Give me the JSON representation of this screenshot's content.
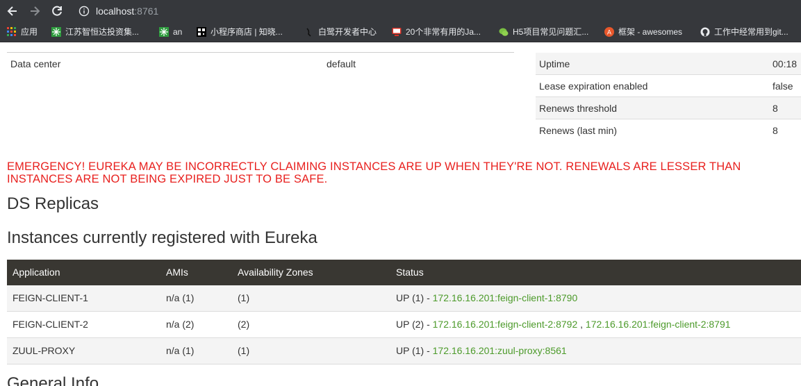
{
  "browser": {
    "url_host": "localhost",
    "url_port": ":8761",
    "bookmarks": [
      {
        "label": "应用",
        "icon": "apps-grid-icon"
      },
      {
        "label": "江苏智恒达投资集...",
        "icon": "green-pattern-icon"
      },
      {
        "label": "an",
        "icon": "green-pattern-icon"
      },
      {
        "label": "小程序商店 | 知晓...",
        "icon": "qr-square-icon"
      },
      {
        "label": "白鹭开发者中心",
        "icon": "egret-icon"
      },
      {
        "label": "20个非常有用的Ja...",
        "icon": "red-monitor-icon"
      },
      {
        "label": "H5项目常见问题汇...",
        "icon": "wechat-icon"
      },
      {
        "label": "框架 - awesomes",
        "icon": "orange-circle-icon"
      },
      {
        "label": "工作中经常用到git...",
        "icon": "github-icon"
      }
    ]
  },
  "env_info": {
    "data_center_label": "Data center",
    "data_center_value": "default"
  },
  "status_info": [
    {
      "key": "Uptime",
      "value": "00:18"
    },
    {
      "key": "Lease expiration enabled",
      "value": "false"
    },
    {
      "key": "Renews threshold",
      "value": "8"
    },
    {
      "key": "Renews (last min)",
      "value": "8"
    }
  ],
  "emergency": {
    "line1": "EMERGENCY! EUREKA MAY BE INCORRECTLY CLAIMING INSTANCES ARE UP WHEN THEY'RE NOT. RENEWALS ARE LESSER THAN",
    "line2": "INSTANCES ARE NOT BEING EXPIRED JUST TO BE SAFE."
  },
  "headings": {
    "replicas": "DS Replicas",
    "instances": "Instances currently registered with Eureka",
    "general": "General Info"
  },
  "instances": {
    "columns": [
      "Application",
      "AMIs",
      "Availability Zones",
      "Status"
    ],
    "rows": [
      {
        "app": "FEIGN-CLIENT-1",
        "amis": "n/a (1)",
        "zones": "(1)",
        "status_prefix": "UP (1) - ",
        "links": [
          "172.16.16.201:feign-client-1:8790"
        ]
      },
      {
        "app": "FEIGN-CLIENT-2",
        "amis": "n/a (2)",
        "zones": "(2)",
        "status_prefix": "UP (2) - ",
        "links": [
          "172.16.16.201:feign-client-2:8792",
          "172.16.16.201:feign-client-2:8791"
        ]
      },
      {
        "app": "ZUUL-PROXY",
        "amis": "n/a (1)",
        "zones": "(1)",
        "status_prefix": "UP (1) - ",
        "links": [
          "172.16.16.201:zuul-proxy:8561"
        ]
      }
    ]
  },
  "colors": {
    "chrome": "#36383c",
    "emergency_red": "#e8201e",
    "table_header": "#393732",
    "link_green": "#4c9a2a"
  }
}
